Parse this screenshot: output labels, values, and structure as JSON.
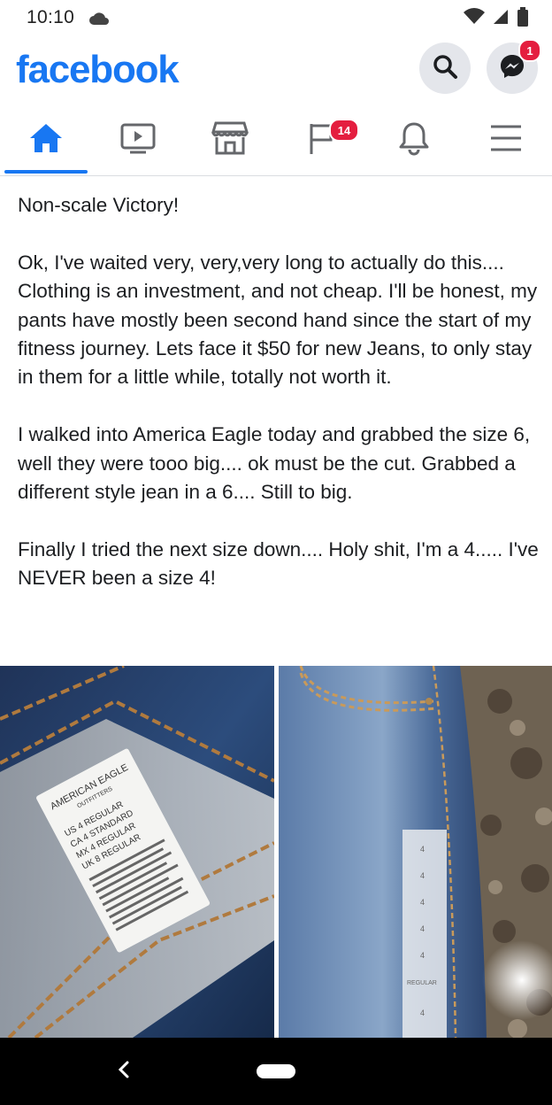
{
  "status_bar": {
    "time": "10:10"
  },
  "header": {
    "logo": "facebook",
    "messenger_badge": "1"
  },
  "tabs": {
    "items": [
      {
        "name": "home",
        "active": true
      },
      {
        "name": "watch"
      },
      {
        "name": "marketplace"
      },
      {
        "name": "pages"
      },
      {
        "name": "notifications"
      },
      {
        "name": "menu"
      }
    ],
    "pages_badge": "14"
  },
  "post": {
    "paragraphs": [
      "Non-scale Victory!",
      "Ok, I've waited very, very,very long to actually do this....  Clothing is an investment,  and not cheap. I'll be honest,  my pants have mostly been second hand since the start of my fitness journey.  Lets face it $50 for new Jeans, to only stay in them for a little while,  totally not worth it.",
      "I walked into America Eagle today and grabbed the size 6, well they were tooo big.... ok must be the cut.  Grabbed a different style jean in a 6.... Still to big.",
      "Finally I tried the next size down....  Holy shit, I'm a 4..... I've NEVER been a size 4!"
    ]
  },
  "photos": {
    "left": {
      "tag_lines": [
        "AMERICAN EAGLE",
        "OUTFITTERS",
        "US 4 REGULAR",
        "CA 4 STANDARD",
        "MX 4 REGULAR",
        "UK 8 REGULAR"
      ]
    },
    "right": {
      "tag_lines": [
        "4",
        "4",
        "4",
        "4",
        "4",
        "REGULAR",
        "4"
      ]
    }
  },
  "colors": {
    "brand": "#1877f2",
    "badge": "#e41e3f"
  }
}
